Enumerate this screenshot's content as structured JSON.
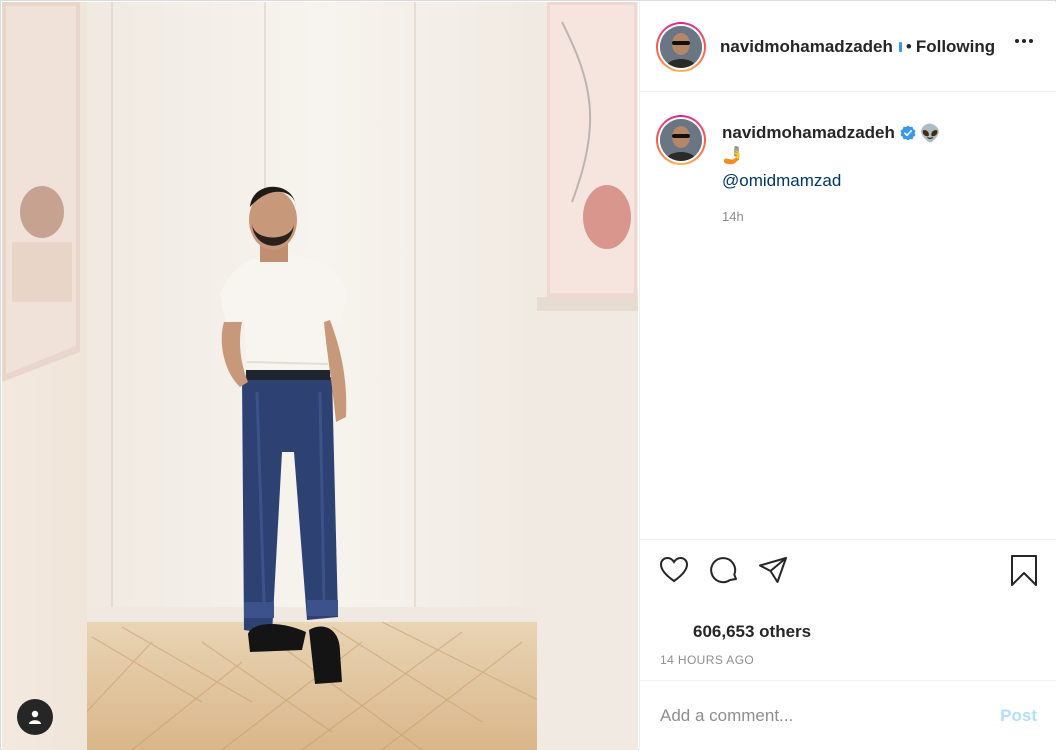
{
  "post": {
    "image_description_icon": "tagged-user-icon"
  },
  "header": {
    "username": "navidmohamadzadeh",
    "separator": "•",
    "follow_state": "Following",
    "more_icon": "ellipsis-icon"
  },
  "caption": {
    "username": "navidmohamadzadeh",
    "verified_icon": "verified-badge-icon",
    "emoji_1": "👽",
    "emoji_2": "🤳",
    "mention": "@omidmamzad",
    "time": "14h"
  },
  "actions": {
    "like_icon": "heart-icon",
    "comment_icon": "comment-icon",
    "share_icon": "share-icon",
    "save_icon": "bookmark-icon"
  },
  "likes_text": "606,653 others",
  "timestamp": "14 HOURS AGO",
  "comment": {
    "placeholder": "Add a comment...",
    "post_label": "Post"
  },
  "colors": {
    "link": "#00376b",
    "verified": "#3897f0",
    "post_disabled": "#b2dffc",
    "muted": "#8e8e8e"
  }
}
